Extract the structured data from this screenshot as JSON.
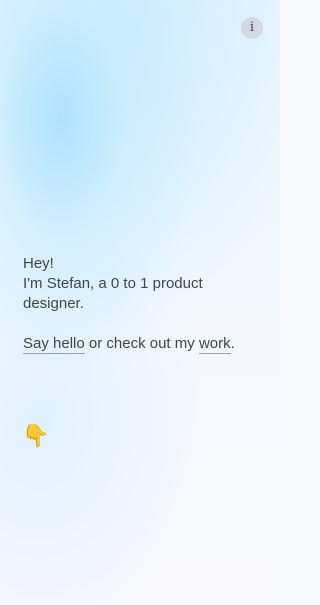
{
  "info_button": {
    "label": "i"
  },
  "intro": {
    "greeting": "Hey!",
    "line1": "I'm Stefan, a 0 to 1 product",
    "line2": "designer."
  },
  "cta": {
    "say_hello": "Say hello",
    "middle": " or check out my ",
    "work": "work",
    "end": "."
  },
  "pointer": {
    "emoji": "👇",
    "icon": "hand-pointing-down-icon"
  }
}
